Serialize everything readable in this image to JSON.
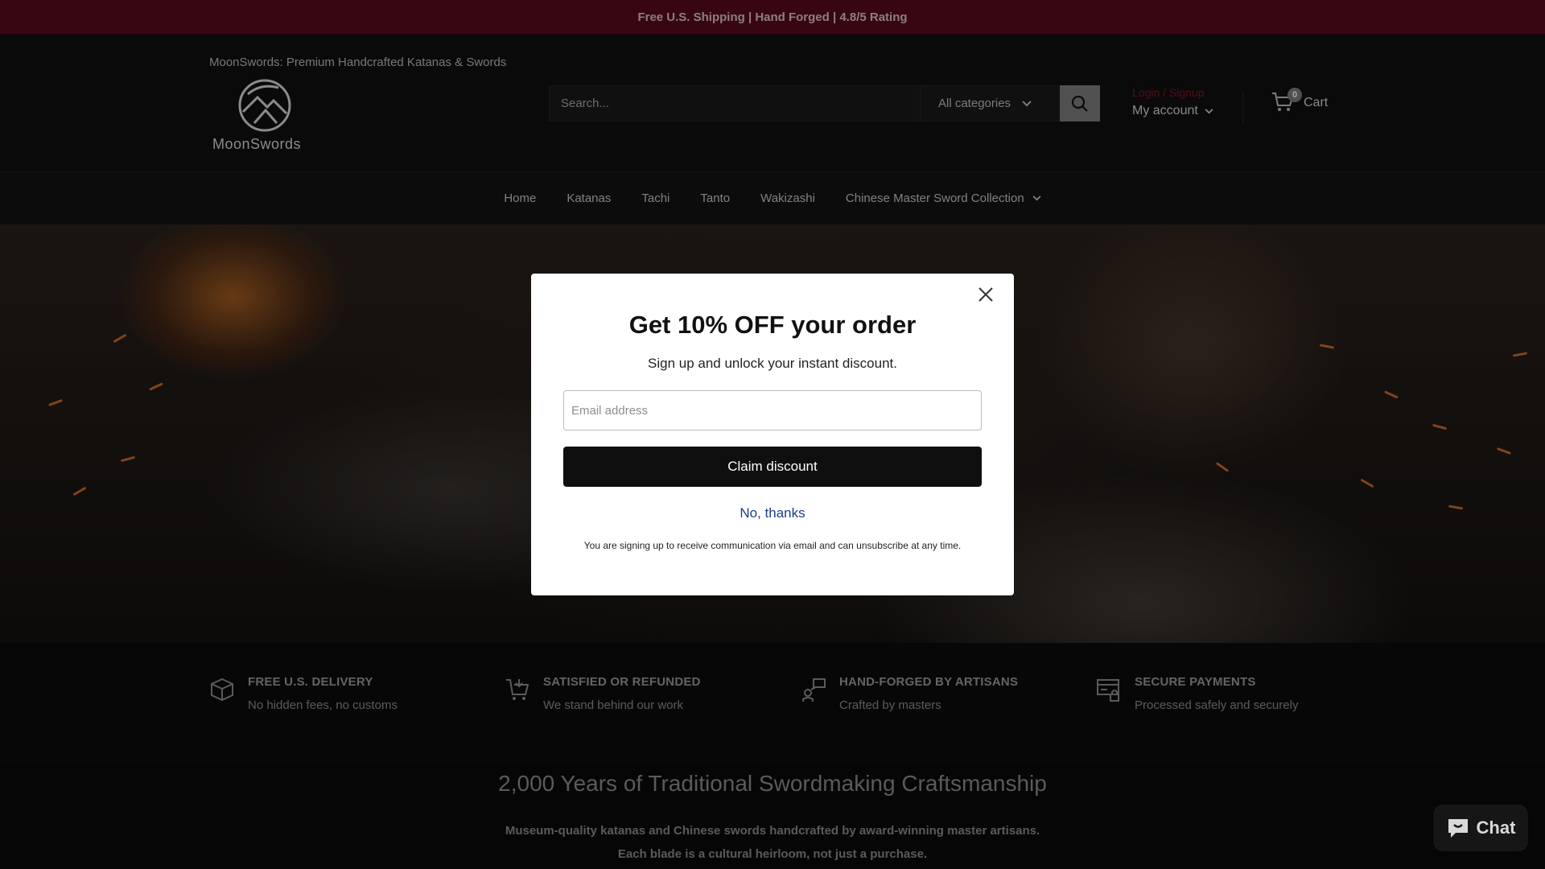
{
  "announcement": "Free U.S. Shipping | Hand Forged | 4.8/5 Rating",
  "header": {
    "tagline": "MoonSwords: Premium Handcrafted Katanas & Swords",
    "logo_text": "MoonSwords",
    "search_placeholder": "Search...",
    "category_selected": "All categories",
    "login_label": "Login / Signup",
    "account_label": "My account",
    "cart_count": "0",
    "cart_label": "Cart"
  },
  "nav": {
    "items": [
      {
        "label": "Home"
      },
      {
        "label": "Katanas"
      },
      {
        "label": "Tachi"
      },
      {
        "label": "Tanto"
      },
      {
        "label": "Wakizashi"
      },
      {
        "label": "Chinese Master Sword Collection"
      }
    ]
  },
  "features": [
    {
      "title": "FREE U.S. DELIVERY",
      "subtitle": "No hidden fees, no customs",
      "icon": "box-icon"
    },
    {
      "title": "SATISFIED OR REFUNDED",
      "subtitle": "We stand behind our work",
      "icon": "cart-return-icon"
    },
    {
      "title": "HAND-FORGED BY ARTISANS",
      "subtitle": "Crafted by masters",
      "icon": "artisan-icon"
    },
    {
      "title": "SECURE PAYMENTS",
      "subtitle": "Processed safely and securely",
      "icon": "secure-payment-icon"
    }
  ],
  "intro": {
    "title": "2,000 Years of Traditional Swordmaking Craftsmanship",
    "text": "Museum-quality katanas and Chinese swords handcrafted by award-winning master artisans. Each blade is a cultural heirloom, not just a purchase."
  },
  "modal": {
    "title": "Get 10% OFF your order",
    "subtitle": "Sign up and unlock your instant discount.",
    "email_placeholder": "Email address",
    "claim_label": "Claim discount",
    "decline_label": "No, thanks",
    "legal": "You are signing up to receive communication via email and can unsubscribe at any time."
  },
  "chat": {
    "label": "Chat"
  },
  "colors": {
    "announcement_bg": "#560a1a",
    "login_link": "#7e1424",
    "modal_button": "#0f0f0f",
    "decline_link": "#1f3b8a"
  }
}
